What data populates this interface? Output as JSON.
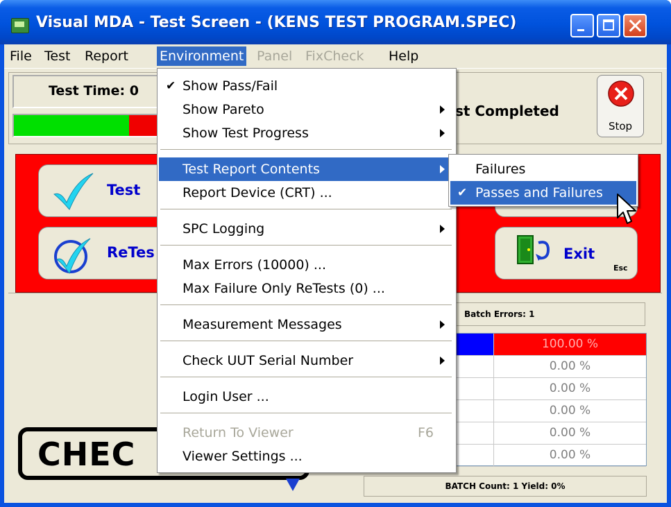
{
  "window": {
    "title": "Visual MDA - Test Screen - (KENS TEST PROGRAM.SPEC)"
  },
  "menubar": {
    "items": [
      {
        "label": "File",
        "state": "normal"
      },
      {
        "label": "Test",
        "state": "normal"
      },
      {
        "label": "Report",
        "state": "normal"
      },
      {
        "label": "Environment",
        "state": "active"
      },
      {
        "label": "Panel",
        "state": "disabled"
      },
      {
        "label": "FixCheck",
        "state": "disabled"
      },
      {
        "label": "Help",
        "state": "normal"
      }
    ]
  },
  "top_panel": {
    "test_time_label": "Test Time: 0",
    "status_text": "st Completed",
    "progress": {
      "green_fraction": 0.4,
      "red_fraction": 0.6
    },
    "stop_label": "Stop"
  },
  "action_panel": {
    "test_label": "Test",
    "retest_label": "ReTes",
    "exit_label": "Exit",
    "exit_shortcut": "Esc"
  },
  "batch": {
    "errors_label": "Batch Errors: 1",
    "rows": [
      "100.00 %",
      "0.00 %",
      "0.00 %",
      "0.00 %",
      "0.00 %",
      "0.00 %"
    ],
    "count_label": "BATCH Count: 1  Yield: 0%"
  },
  "logo": {
    "text": "CHEC"
  },
  "environment_menu": {
    "items": [
      {
        "label": "Show Pass/Fail",
        "checked": true
      },
      {
        "label": "Show Pareto",
        "submenu": true
      },
      {
        "label": "Show Test Progress",
        "submenu": true
      },
      {
        "label": "Test Report Contents",
        "submenu": true,
        "highlighted": true
      },
      {
        "label": "Report Device (CRT) ..."
      },
      {
        "label": "SPC Logging",
        "submenu": true
      },
      {
        "label": "Max Errors  (10000) ..."
      },
      {
        "label": "Max Failure Only ReTests (0) ..."
      },
      {
        "label": "Measurement Messages",
        "submenu": true
      },
      {
        "label": "Check UUT Serial Number",
        "submenu": true
      },
      {
        "label": "Login User ..."
      },
      {
        "label": "Return To Viewer",
        "shortcut": "F6",
        "disabled": true
      },
      {
        "label": "Viewer Settings ..."
      }
    ]
  },
  "report_contents_submenu": {
    "items": [
      {
        "label": "Failures",
        "checked": false
      },
      {
        "label": "Passes and Failures",
        "checked": true,
        "highlighted": true
      }
    ]
  },
  "colors": {
    "title_blue": "#0052dc",
    "menu_highlight": "#316ac5",
    "panel_red": "#ff0000",
    "progress_green": "#00e000",
    "batch_fail_red": "#ff0000",
    "batch_pass_blue": "#0000ff"
  }
}
